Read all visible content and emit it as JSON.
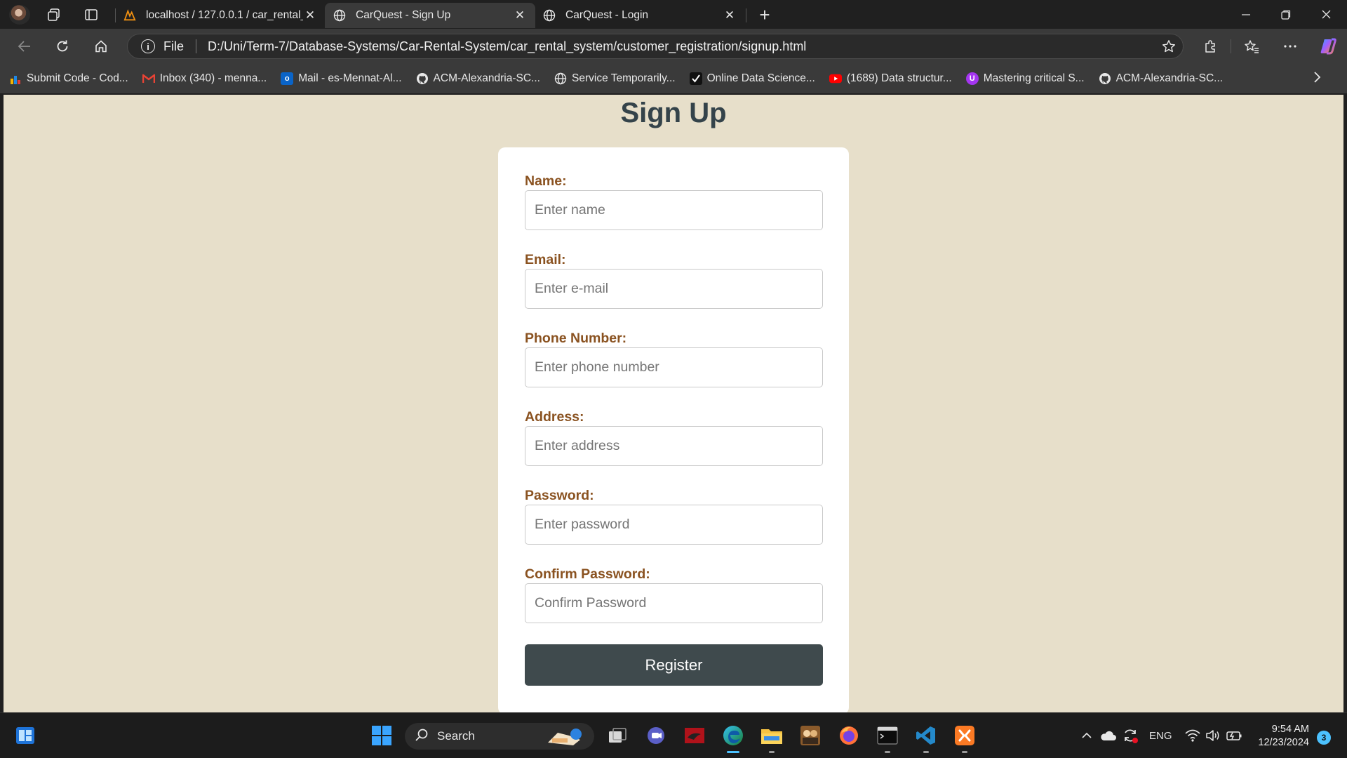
{
  "browser": {
    "tabs": [
      {
        "title": "localhost / 127.0.0.1 / car_rental_s",
        "icon": "phpmyadmin-icon",
        "active": false
      },
      {
        "title": "CarQuest - Sign Up",
        "icon": "globe-icon",
        "active": true
      },
      {
        "title": "CarQuest - Login",
        "icon": "globe-icon",
        "active": false
      }
    ],
    "address": {
      "scheme": "File",
      "url": "D:/Uni/Term-7/Database-Systems/Car-Rental-System/car_rental_system/customer_registration/signup.html"
    },
    "bookmarks": [
      {
        "label": "Submit Code - Cod...",
        "icon": "bar-chart-icon",
        "color": "#f4b400"
      },
      {
        "label": "Inbox (340) - menna...",
        "icon": "gmail-icon",
        "color": "#ea4335"
      },
      {
        "label": "Mail - es-Mennat-Al...",
        "icon": "outlook-icon",
        "color": "#0a64c8"
      },
      {
        "label": "ACM-Alexandria-SC...",
        "icon": "github-icon",
        "color": "#e8e8e8"
      },
      {
        "label": "Service Temporarily...",
        "icon": "globe-icon",
        "color": "#e8e8e8"
      },
      {
        "label": "Online Data Science...",
        "icon": "checkmark-icon",
        "color": "#111111"
      },
      {
        "label": "(1689) Data structur...",
        "icon": "youtube-icon",
        "color": "#ff0000"
      },
      {
        "label": "Mastering critical S...",
        "icon": "udemy-icon",
        "color": "#a435f0"
      },
      {
        "label": "ACM-Alexandria-SC...",
        "icon": "github-icon",
        "color": "#e8e8e8"
      }
    ]
  },
  "page": {
    "title": "Sign Up",
    "form": {
      "fields": [
        {
          "label": "Name:",
          "placeholder": "Enter name"
        },
        {
          "label": "Email:",
          "placeholder": "Enter e-mail"
        },
        {
          "label": "Phone Number:",
          "placeholder": "Enter phone number"
        },
        {
          "label": "Address:",
          "placeholder": "Enter address"
        },
        {
          "label": "Password:",
          "placeholder": "Enter password"
        },
        {
          "label": "Confirm Password:",
          "placeholder": "Confirm Password"
        }
      ],
      "submit_label": "Register"
    },
    "colors": {
      "background": "#e7dfca",
      "label": "#8a5220",
      "button": "#3f4a4d",
      "title": "#34434a"
    }
  },
  "taskbar": {
    "search_label": "Search",
    "language": "ENG",
    "time": "9:54 AM",
    "date": "12/23/2024",
    "notification_count": "3"
  }
}
